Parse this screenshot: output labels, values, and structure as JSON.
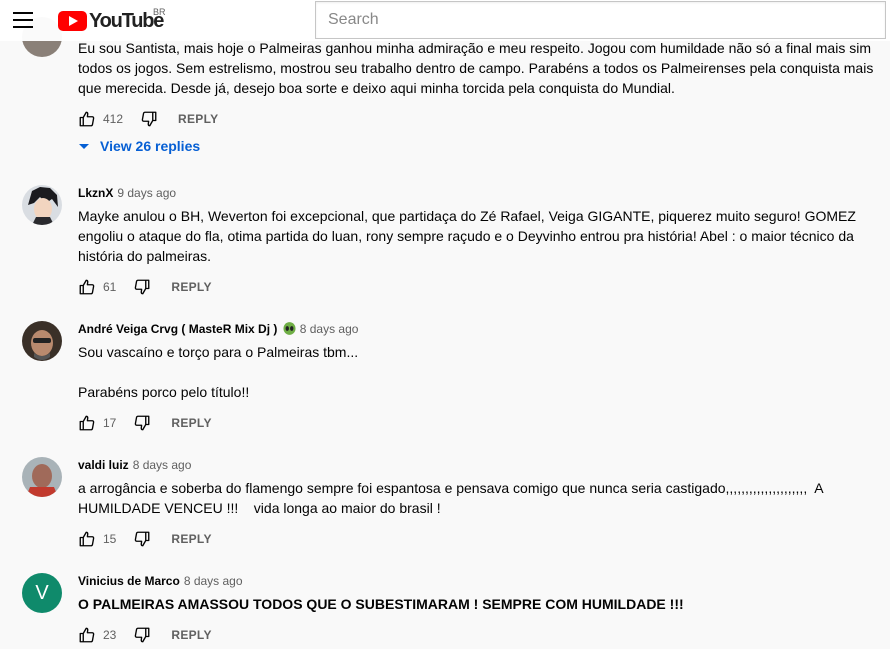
{
  "header": {
    "logo_text": "YouTube",
    "country": "BR",
    "search_placeholder": "Search"
  },
  "top_comment": {
    "text_partial": "Eu sou Santista, mais hoje o Palmeiras ganhou minha admiração e meu respeito. Jogou com humildade não só a final mais sim\ntodos os jogos. Sem estrelismo, mostrou seu trabalho dentro de campo. Parabéns a todos os Palmeirenses pela conquista mais\nque merecida. Desde já, desejo boa sorte e deixo aqui minha torcida pela conquista do Mundial.",
    "likes": "412",
    "reply_label": "REPLY",
    "view_replies": "View 26 replies"
  },
  "comments": [
    {
      "author": "LkznX",
      "time": "9 days ago",
      "text": "Mayke anulou o BH, Weverton foi excepcional, que partidaça do Zé Rafael, Veiga GIGANTE, piquerez muito seguro! GOMEZ\nengoliu o ataque do fla, otima partida do luan, rony sempre raçudo e o Deyvinho entrou pra história! Abel : o maior técnico da\nhistória do palmeiras.",
      "likes": "61",
      "reply_label": "REPLY"
    },
    {
      "author": "André Veiga Crvg ( MasteR Mix Dj )",
      "time": "8 days ago",
      "text": "Sou vascaíno e torço para o Palmeiras tbm...\n\nParabéns porco pelo título!!",
      "likes": "17",
      "reply_label": "REPLY"
    },
    {
      "author": "valdi luiz",
      "time": "8 days ago",
      "text": "a arrogância e soberba do flamengo sempre foi espantosa e pensava comigo que nunca seria castigado,,,,,,,,,,,,,,,,,,,,,  A\nHUMILDADE VENCEU !!!    vida longa ao maior do brasil !",
      "likes": "15",
      "reply_label": "REPLY"
    },
    {
      "author": "Vinicius de Marco",
      "avatar_letter": "V",
      "time": "8 days ago",
      "text": "O PALMEIRAS AMASSOU TODOS QUE O SUBESTIMARAM ! SEMPRE COM HUMILDADE !!!",
      "likes": "23",
      "reply_label": "REPLY"
    }
  ],
  "colors": {
    "brand_red": "#ff0000",
    "link_blue": "#065fd4",
    "meta_gray": "#606060"
  }
}
